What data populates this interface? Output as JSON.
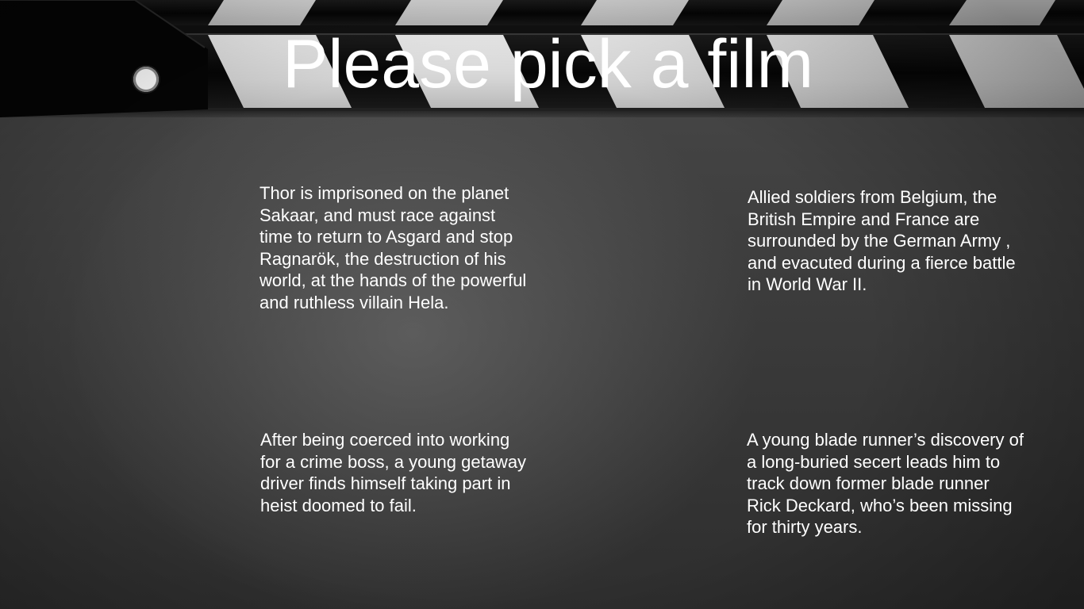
{
  "title": "Please pick a film",
  "films": [
    {
      "description": "Thor is imprisoned on the planet Sakaar, and must race against time to return to Asgard and stop Ragnarök, the destruction of his world, at the hands of the powerful and ruthless villain Hela."
    },
    {
      "description": "Allied soldiers from Belgium, the British Empire and France are surrounded by the German Army , and evacuted during a fierce battle in World War II."
    },
    {
      "description": "After being coerced into working for a crime boss, a young getaway driver finds himself taking part in heist doomed to fail."
    },
    {
      "description": "A young blade runner’s discovery of a long-buried secert leads him to track down former blade runner Rick Deckard, who’s been missing for thirty years."
    }
  ],
  "colors": {
    "background": "#3e3e3e",
    "clapper_black": "#0a0a0a",
    "clapper_stripe": "#d9d9d9",
    "text": "#ffffff"
  },
  "icons": {
    "hinge": "hinge-pin-icon"
  }
}
